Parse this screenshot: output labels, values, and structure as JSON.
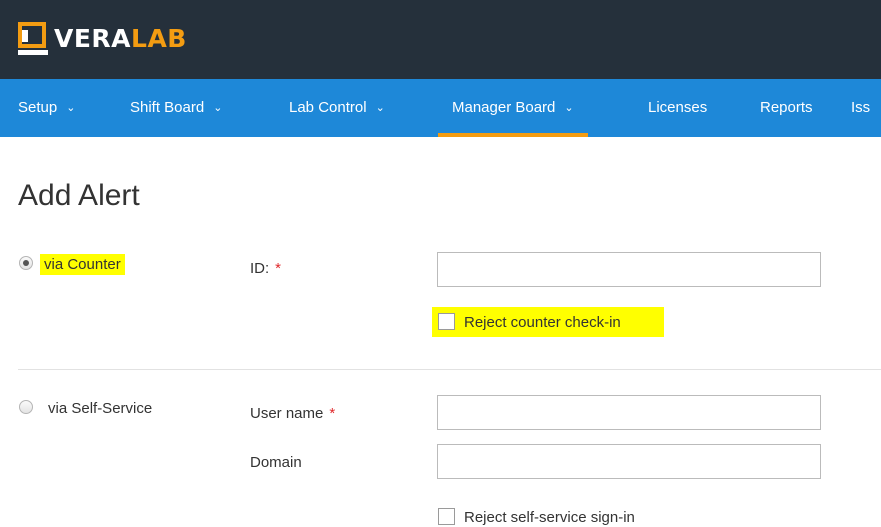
{
  "brand": {
    "name_part1": "VERA",
    "name_part2": "LAB",
    "accent_color": "#f39c12",
    "header_bg": "#25303b"
  },
  "nav": {
    "bg": "#1e88d8",
    "items": [
      {
        "label": "Setup",
        "has_dropdown": true
      },
      {
        "label": "Shift Board",
        "has_dropdown": true
      },
      {
        "label": "Lab Control",
        "has_dropdown": true
      },
      {
        "label": "Manager Board",
        "has_dropdown": true,
        "active": true
      },
      {
        "label": "Licenses",
        "has_dropdown": false
      },
      {
        "label": "Reports",
        "has_dropdown": false
      },
      {
        "label": "Iss",
        "has_dropdown": false
      }
    ],
    "chevron": "⌄"
  },
  "page": {
    "title": "Add Alert"
  },
  "counter_section": {
    "radio_label": "via Counter",
    "radio_checked": true,
    "id_label": "ID:",
    "required_mark": "*",
    "id_value": "",
    "checkbox_label_a": "Reject counter check-",
    "checkbox_label_b": "in",
    "checkbox_checked": false
  },
  "self_service_section": {
    "radio_label": "via Self-Service",
    "radio_checked": false,
    "username_label": "User name",
    "required_mark": "*",
    "username_value": "",
    "domain_label": "Domain",
    "domain_value": "",
    "checkbox_label": "Reject self-service sign-in",
    "checkbox_checked": false
  },
  "highlight_color": "#ffff00"
}
